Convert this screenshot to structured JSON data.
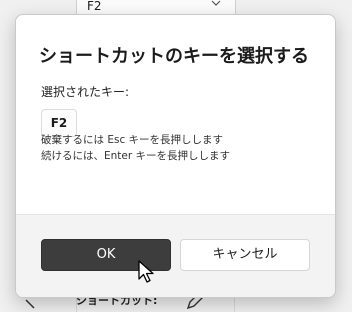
{
  "background": {
    "dropdown_value": "F2",
    "shortcut_label": "ショートカット:"
  },
  "dialog": {
    "title": "ショートカットのキーを選択する",
    "selected_key_label": "選択されたキー:",
    "selected_key": "F2",
    "hint_cancel": "破棄するには Esc キーを長押しします",
    "hint_continue": "続けるには、Enter キーを長押しします",
    "ok_label": "OK",
    "cancel_label": "キャンセル"
  },
  "colors": {
    "ok_button": "#3d3d3d",
    "dialog_bg": "#ffffff",
    "footer_bg": "#f3f3f3"
  },
  "icons": {
    "dropdown": "chevron-down-icon",
    "edit": "pencil-icon",
    "pointer": "mouse-pointer-icon"
  }
}
